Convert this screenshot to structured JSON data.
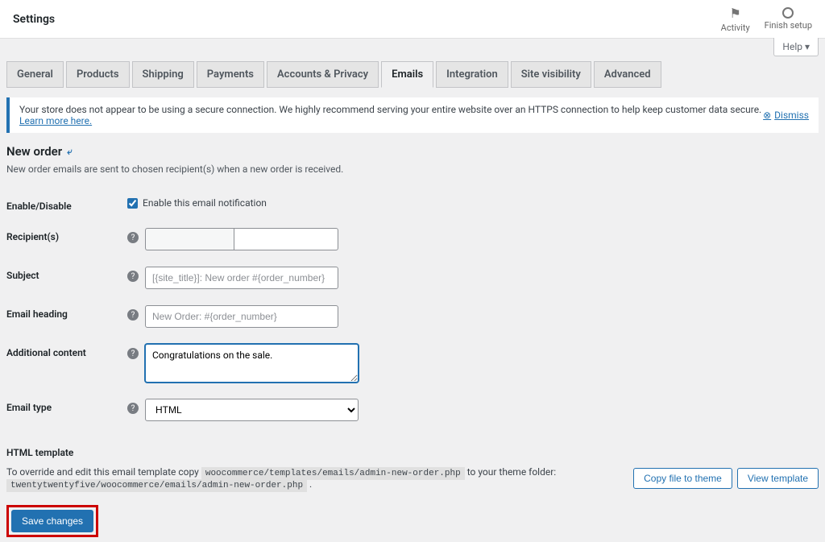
{
  "header": {
    "title": "Settings",
    "activity": "Activity",
    "finish_setup": "Finish setup",
    "help": "Help ▾"
  },
  "tabs": [
    "General",
    "Products",
    "Shipping",
    "Payments",
    "Accounts & Privacy",
    "Emails",
    "Integration",
    "Site visibility",
    "Advanced"
  ],
  "active_tab_index": 5,
  "notice": {
    "text": "Your store does not appear to be using a secure connection. We highly recommend serving your entire website over an HTTPS connection to help keep customer data secure.",
    "link": "Learn more here.",
    "dismiss": "Dismiss"
  },
  "page": {
    "title": "New order",
    "back": "⤶",
    "desc": "New order emails are sent to chosen recipient(s) when a new order is received."
  },
  "form": {
    "enable_label": "Enable/Disable",
    "enable_checkbox": "Enable this email notification",
    "recipients_label": "Recipient(s)",
    "subject_label": "Subject",
    "subject_placeholder": "[{site_title}]: New order #{order_number}",
    "heading_label": "Email heading",
    "heading_placeholder": "New Order: #{order_number}",
    "additional_label": "Additional content",
    "additional_value": "Congratulations on the sale.",
    "emailtype_label": "Email type",
    "emailtype_value": "HTML"
  },
  "template": {
    "title": "HTML template",
    "prefix": "To override and edit this email template copy",
    "src": "woocommerce/templates/emails/admin-new-order.php",
    "mid": "to your theme folder:",
    "dst": "twentytwentyfive/woocommerce/emails/admin-new-order.php",
    "copy_btn": "Copy file to theme",
    "view_btn": "View template"
  },
  "save": "Save changes"
}
